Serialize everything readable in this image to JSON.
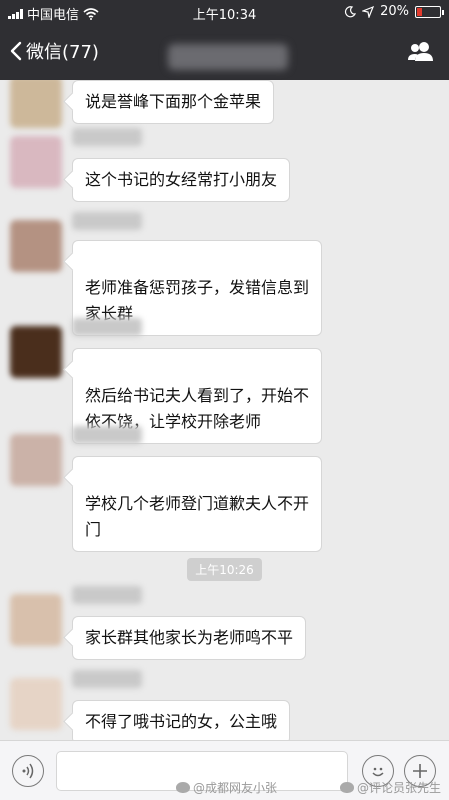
{
  "status_bar": {
    "carrier": "中国电信",
    "time": "上午10:34",
    "battery": "20%",
    "battery_level": 0.2
  },
  "nav": {
    "back_label": "微信(77)"
  },
  "messages": [
    {
      "text": "说是誉峰下面那个金苹果"
    },
    {
      "text": "这个书记的女经常打小朋友"
    },
    {
      "text": "老师准备惩罚孩子，发错信息到\n家长群"
    },
    {
      "text": "然后给书记夫人看到了，开始不\n依不饶，让学校开除老师"
    },
    {
      "text": "学校几个老师登门道歉夫人不开\n门"
    },
    {
      "text": "家长群其他家长为老师鸣不平"
    },
    {
      "text": "不得了哦书记的女，公主哦"
    }
  ],
  "timestamp": "上午10:26",
  "watermarks": [
    "@成都网友小张",
    "@评论员张先生"
  ],
  "colors": {
    "nav_bg": "#2f2f33",
    "chat_bg": "#ebebeb",
    "bubble_bg": "#ffffff",
    "battery_low": "#e23b2e"
  }
}
